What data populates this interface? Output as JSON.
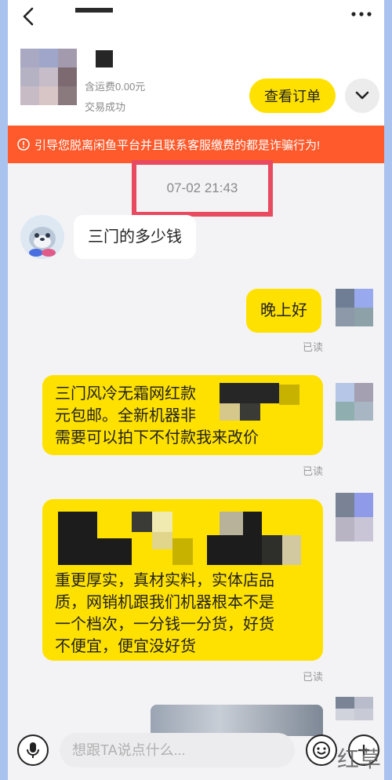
{
  "header": {
    "price_text": "含运费0.00元",
    "status_text": "交易成功",
    "order_button": "查看订单",
    "back_icon": "back-arrow-icon",
    "more_icon": "more-dots-icon",
    "expand_icon": "chevron-down-icon"
  },
  "warning": {
    "text": "引导您脱离闲鱼平台并且联系客服缴费的都是诈骗行为!",
    "icon": "alert-circle-icon",
    "color": "#ff5a2c"
  },
  "timestamp": "07-02 21:43",
  "messages": [
    {
      "side": "in",
      "text": "三门的多少钱"
    },
    {
      "side": "out",
      "text": "晚上好",
      "status": "已读"
    },
    {
      "side": "out",
      "lines": [
        "三门风冷无霜网红款",
        "元包邮。全新机器非",
        "需要可以拍下不付款我来改价"
      ],
      "status": "已读"
    },
    {
      "side": "out",
      "lines": [
        "重更厚实，真材实料，实体店品",
        "质，网销机跟我们机器根本不是",
        "一个档次，一分钱一分货，好货",
        "不便宜，便宜没好货"
      ],
      "status": "已读"
    }
  ],
  "input": {
    "placeholder": "想跟TA说点什么..."
  },
  "watermark": "红草",
  "colors": {
    "accent_yellow": "#ffe100",
    "highlight_red": "#e84a5f",
    "background": "#f3f3f5"
  }
}
